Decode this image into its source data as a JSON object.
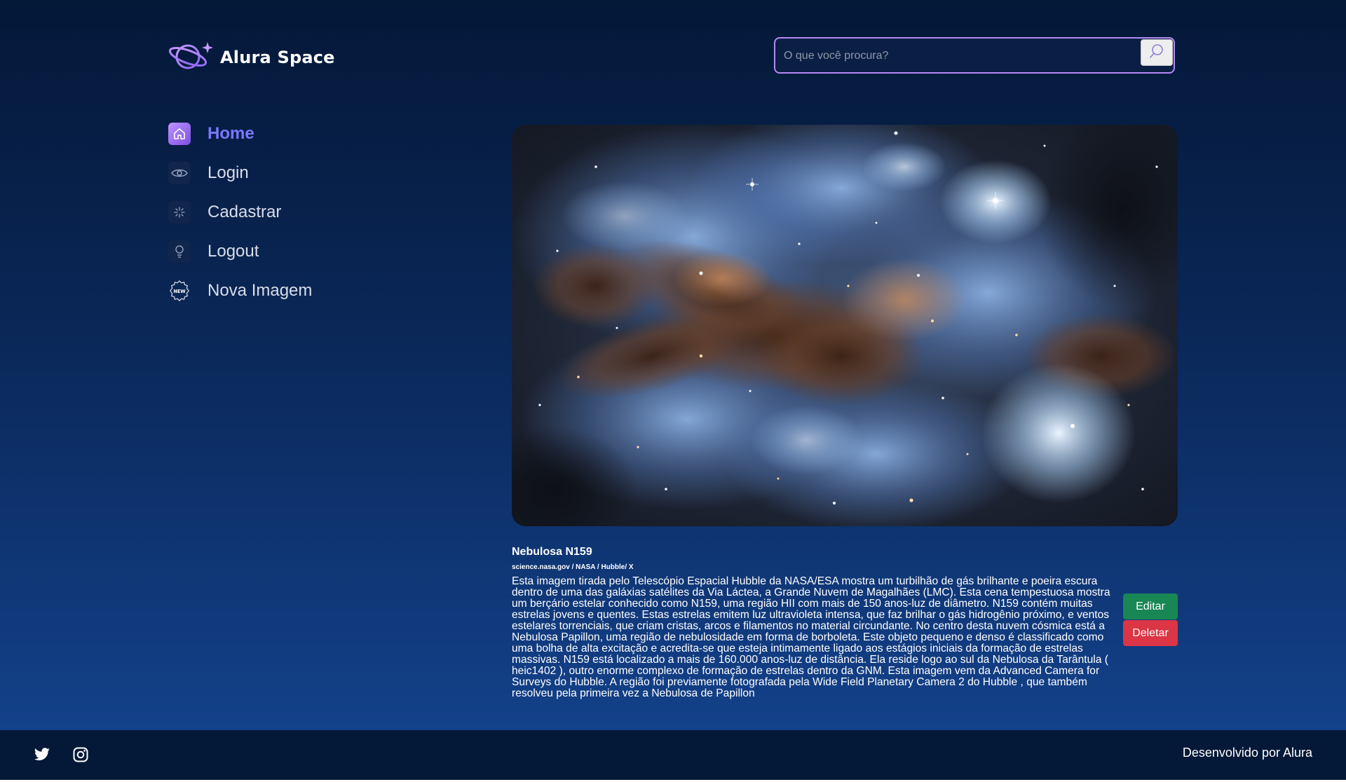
{
  "header": {
    "logo_text": "Alura Space",
    "search_placeholder": "O que você procura?"
  },
  "nav": {
    "items": [
      {
        "label": "Home",
        "icon": "home-icon",
        "active": true
      },
      {
        "label": "Login",
        "icon": "eye-icon"
      },
      {
        "label": "Cadastrar",
        "icon": "sparkle-icon"
      },
      {
        "label": "Logout",
        "icon": "lightbulb-icon"
      },
      {
        "label": "Nova Imagem",
        "icon": "new-badge-icon"
      }
    ]
  },
  "post": {
    "title": "Nebulosa N159",
    "source": "science.nasa.gov / NASA / Hubble/ X",
    "description": "Esta imagem tirada pelo Telescópio Espacial Hubble da NASA/ESA mostra um turbilhão de gás brilhante e poeira escura dentro de uma das galáxias satélites da Via Láctea, a Grande Nuvem de Magalhães (LMC). Esta cena tempestuosa mostra um berçário estelar conhecido como N159, uma região HII com mais de 150 anos-luz de diâmetro. N159 contém muitas estrelas jovens e quentes. Estas estrelas emitem luz ultravioleta intensa, que faz brilhar o gás hidrogênio próximo, e ventos estelares torrenciais, que criam cristas, arcos e filamentos no material circundante. No centro desta nuvem cósmica está a Nebulosa Papillon, uma região de nebulosidade em forma de borboleta. Este objeto pequeno e denso é classificado como uma bolha de alta excitação e acredita-se que esteja intimamente ligado aos estágios iniciais da formação de estrelas massivas. N159 está localizado a mais de 160.000 anos-luz de distância. Ela reside logo ao sul da Nebulosa da Tarântula ( heic1402 ), outro enorme complexo de formação de estrelas dentro da GNM. Esta imagem vem da Advanced Camera for Surveys do Hubble. A região foi previamente fotografada pela Wide Field Planetary Camera 2 do Hubble , que também resolveu pela primeira vez a Nebulosa de Papillon",
    "edit_label": "Editar",
    "delete_label": "Deletar"
  },
  "footer": {
    "credit": "Desenvolvido por Alura",
    "social": [
      "twitter-icon",
      "instagram-icon"
    ]
  },
  "colors": {
    "accent": "#b489f2",
    "active_nav": "#7b78ff",
    "edit": "#198754",
    "delete": "#dc3545",
    "background_top": "#041838",
    "background_bottom": "#13418a"
  }
}
